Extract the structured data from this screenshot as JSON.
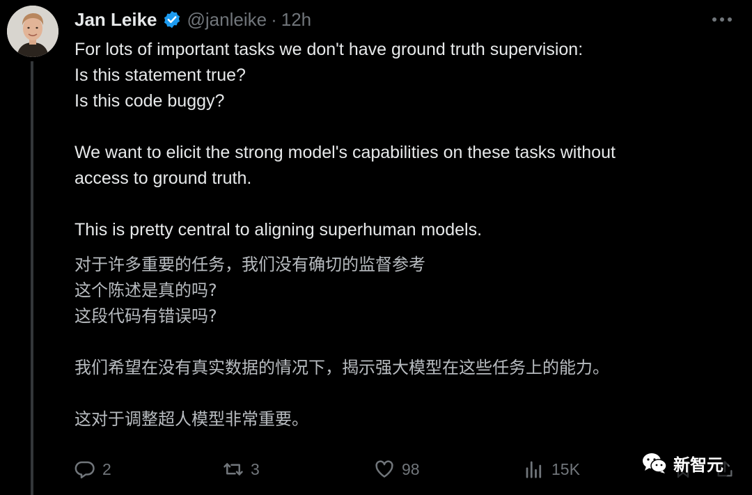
{
  "author": {
    "name": "Jan Leike",
    "handle": "@janleike",
    "separator": "·",
    "time": "12h"
  },
  "tweet": {
    "lines": [
      "For lots of important tasks we don't have ground truth supervision:",
      "Is this statement true?",
      "Is this code buggy?",
      "",
      "We want to elicit the strong model's capabilities on these tasks without",
      "access to ground truth.",
      "",
      "This is pretty central to aligning superhuman models."
    ]
  },
  "translation": {
    "lines": [
      "对于许多重要的任务，我们没有确切的监督参考",
      "这个陈述是真的吗?",
      "这段代码有错误吗?",
      "",
      "我们希望在没有真实数据的情况下，揭示强大模型在这些任务上的能力。",
      "",
      "这对于调整超人模型非常重要。"
    ]
  },
  "actions": {
    "replies": "2",
    "retweets": "3",
    "likes": "98",
    "views": "15K"
  },
  "watermark": {
    "text": "新智元"
  },
  "colors": {
    "background": "#000000",
    "text": "#e7e9ea",
    "muted": "#71767b",
    "verified": "#1d9bf0"
  },
  "icons": [
    "verified-badge-icon",
    "more-icon",
    "reply-icon",
    "retweet-icon",
    "like-icon",
    "views-icon",
    "bookmark-icon",
    "share-icon",
    "wechat-icon"
  ]
}
